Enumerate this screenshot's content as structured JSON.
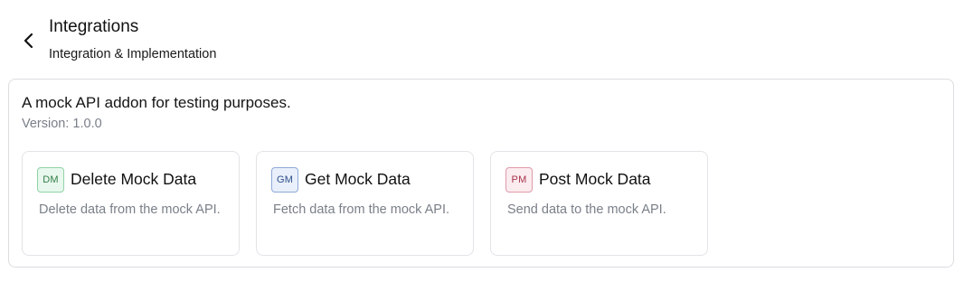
{
  "header": {
    "title": "Integrations",
    "subtitle": "Integration & Implementation",
    "back_icon": "chevron-left-icon"
  },
  "addon": {
    "description": "A mock API addon for testing purposes.",
    "version": "Version: 1.0.0"
  },
  "actions": [
    {
      "badge": "DM",
      "badge_color": "#2f7d46",
      "title": "Delete Mock Data",
      "description": "Delete data from the mock API."
    },
    {
      "badge": "GM",
      "badge_color": "#2d4e8c",
      "title": "Get Mock Data",
      "description": "Fetch data from the mock API."
    },
    {
      "badge": "PM",
      "badge_color": "#a8344c",
      "title": "Post Mock Data",
      "description": "Send data to the mock API."
    }
  ]
}
